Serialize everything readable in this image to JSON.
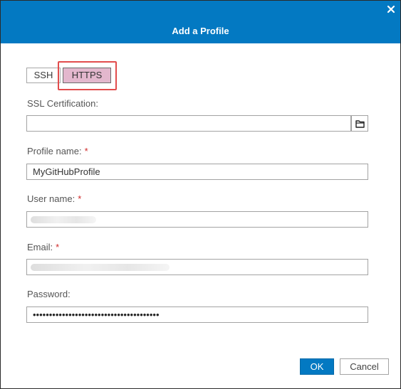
{
  "dialog": {
    "title": "Add a Profile",
    "close_icon": "close-icon"
  },
  "protocol": {
    "options": [
      "SSH",
      "HTTPS"
    ],
    "selected": "HTTPS",
    "highlight_color": "#e24c4c",
    "selected_color": "#e3b7cd"
  },
  "form": {
    "ssl_certification": {
      "label": "SSL Certification:",
      "value": "",
      "browse_icon": "folder-icon"
    },
    "profile_name": {
      "label": "Profile name:",
      "required_marker": "*",
      "value": "MyGitHubProfile"
    },
    "user_name": {
      "label": "User name:",
      "required_marker": "*",
      "value": ""
    },
    "email": {
      "label": "Email:",
      "required_marker": "*",
      "value": ""
    },
    "password": {
      "label": "Password:",
      "value": "•••••••••••••••••••••••••••••••••••••••"
    }
  },
  "buttons": {
    "ok": "OK",
    "cancel": "Cancel"
  },
  "colors": {
    "accent": "#0379c2",
    "required": "#d02b2b"
  }
}
